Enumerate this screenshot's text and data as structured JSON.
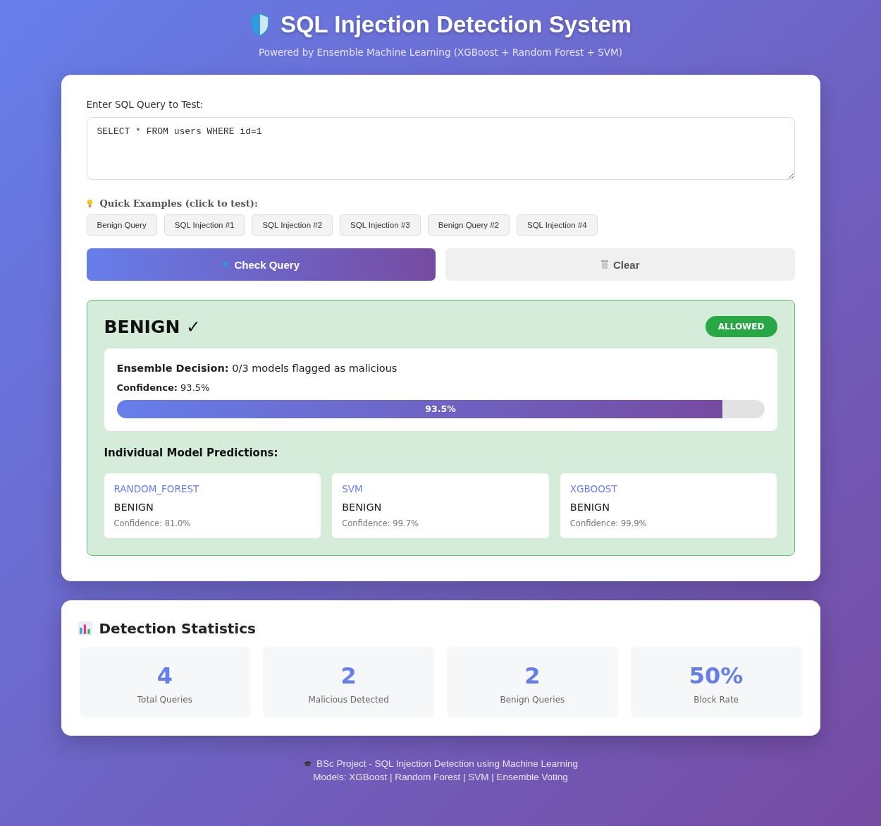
{
  "header": {
    "title": "SQL Injection Detection System",
    "subtitle": "Powered by Ensemble Machine Learning (XGBoost + Random Forest + SVM)"
  },
  "query": {
    "label": "Enter SQL Query to Test:",
    "value": "SELECT * FROM users WHERE id=1"
  },
  "examples": {
    "label": "Quick Examples (click to test):",
    "items": [
      "Benign Query",
      "SQL Injection #1",
      "SQL Injection #2",
      "SQL Injection #3",
      "Benign Query #2",
      "SQL Injection #4"
    ]
  },
  "actions": [
    {
      "kind": "check",
      "label": "Check Query"
    },
    {
      "kind": "clear",
      "label": "Clear"
    }
  ],
  "result": {
    "kind": "benign",
    "title": "BENIGN ✓",
    "badge": "ALLOWED",
    "decision": "**Ensemble Decision:** 0/3 models flagged as malicious",
    "confidence": "**Confidence:** 93.5%",
    "level": 0.935,
    "bar_label": "93.5%",
    "models_heading": "Individual Model Predictions:",
    "models": [
      {
        "name": "RANDOM_FOREST",
        "prediction": "BENIGN",
        "confidence": "Confidence: 81.0%"
      },
      {
        "name": "SVM",
        "prediction": "BENIGN",
        "confidence": "Confidence: 99.7%"
      },
      {
        "name": "XGBOOST",
        "prediction": "BENIGN",
        "confidence": "Confidence: 99.9%"
      }
    ]
  },
  "statistics": {
    "title": "Detection Statistics",
    "items": [
      {
        "value": "4",
        "label": "Total Queries"
      },
      {
        "value": "2",
        "label": "Malicious Detected"
      },
      {
        "value": "2",
        "label": "Benign Queries"
      },
      {
        "value": "50%",
        "label": "Block Rate"
      }
    ]
  },
  "footer": [
    "BSc Project - SQL Injection Detection using Machine Learning",
    "Models: XGBoost | Random Forest | SVM | Ensemble Voting"
  ]
}
